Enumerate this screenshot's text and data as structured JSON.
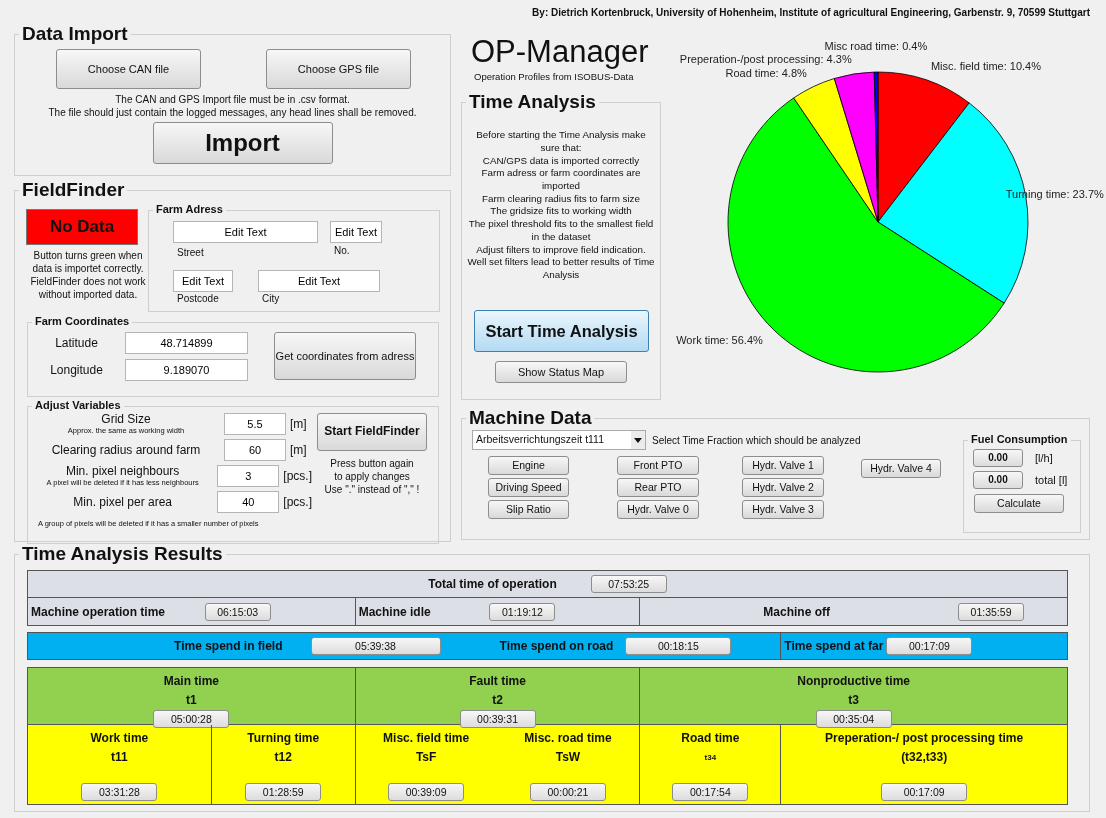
{
  "credit": "By: Dietrich Kortenbruck, University of Hohenheim, Institute of agricultural Engineering, Garbenstr. 9, 70599 Stuttgart",
  "data_import": {
    "title": "Data Import",
    "buttons": [
      "Choose CAN file",
      "Choose GPS file"
    ],
    "notes": [
      "The CAN and GPS Import file must be in .csv format.",
      "The file should just contain the logged messages, any head lines shall be removed."
    ],
    "import_button": "Import"
  },
  "field_finder": {
    "title": "FieldFinder",
    "status": {
      "label": "No Data",
      "has_data": false
    },
    "status_note": "Button turns green when data is importet correctly. FieldFinder does not work without imported data.",
    "farm_address": {
      "title": "Farm Adress",
      "inputs": [
        "Edit Text",
        "Edit Text",
        "Edit Text",
        "Edit Text"
      ],
      "captions": [
        "Street",
        "No.",
        "Postcode",
        "City"
      ]
    },
    "farm_coordinates": {
      "title": "Farm Coordinates",
      "fields": [
        {
          "label": "Latitude",
          "value": "48.714899"
        },
        {
          "label": "Longitude",
          "value": "9.189070"
        }
      ],
      "button": "Get coordinates from adress"
    },
    "adjust_variables": {
      "title": "Adjust Variables",
      "rows": [
        {
          "label": "Grid Size",
          "hint": "Approx. the same as working width",
          "value": "5.5",
          "unit": "[m]"
        },
        {
          "label": "Clearing radius around farm",
          "value": "60",
          "unit": "[m]"
        },
        {
          "label": "Min. pixel neighbours",
          "hint": "A pixel will be deleted if it has less neighbours",
          "value": "3",
          "unit": "[pcs.]"
        },
        {
          "label": "Min. pixel per area",
          "value": "40",
          "unit": "[pcs.]"
        }
      ],
      "footnote": "A group of pixels will be deleted if it has a smaller number of pixels",
      "button": "Start FieldFinder",
      "button_note_lines": [
        "Press button again",
        "to apply changes",
        "Use \".\" instead of \",\" !"
      ]
    }
  },
  "app": {
    "title": "OP-Manager",
    "subtitle": "Operation Profiles from ISOBUS-Data"
  },
  "time_analysis": {
    "title": "Time Analysis",
    "instructions": [
      "Before starting the Time Analysis make sure that:",
      "CAN/GPS data is imported correctly",
      "Farm adress or farm coordinates are imported",
      "Farm clearing radius fits to farm size",
      "The gridsize fits to working width",
      "The pixel threshold fits to the smallest field in the dataset",
      "Adjust filters to improve field indication.",
      "Well set filters lead to better results of Time Analysis"
    ],
    "start_button": {
      "label": "Start Time Analysis",
      "focused": true
    },
    "map_button": "Show Status Map"
  },
  "pie": {
    "chart_data": {
      "type": "pie",
      "values": [
        10.4,
        23.7,
        56.4,
        4.8,
        4.3,
        0.4
      ],
      "colors": [
        "#ff0000",
        "#00ffff",
        "#00ff00",
        "#ffff00",
        "#ff00ff",
        "#0000ff"
      ],
      "value_labels": [
        "Misc. field time: 10.4%",
        "Turning time: 23.7%",
        "Work time: 56.4%",
        "Road time: 4.8%",
        "Preperation-/post processing: 4.3%",
        "Misc road time: 0.4%"
      ]
    }
  },
  "machine_data": {
    "title": "Machine Data",
    "fraction_select": {
      "value": "Arbeitsverrichtungszeit t111"
    },
    "select_hint": "Select Time Fraction which should be analyzed",
    "button_columns": [
      [
        "Engine",
        "Driving Speed",
        "Slip Ratio"
      ],
      [
        "Front PTO",
        "Rear PTO",
        "Hydr. Valve 0"
      ],
      [
        "Hydr. Valve 1",
        "Hydr. Valve 2",
        "Hydr. Valve 3"
      ],
      [
        "Hydr. Valve 4"
      ]
    ],
    "fuel": {
      "title": "Fuel Consumption",
      "readings": [
        {
          "value": "0.00",
          "unit": "[l/h]"
        },
        {
          "value": "0.00",
          "unit": "total [l]"
        }
      ],
      "button": "Calculate"
    }
  },
  "results": {
    "title": "Time Analysis Results",
    "bands": [
      {
        "kind": "inline",
        "color": "#dcdfe6",
        "entries": [
          {
            "label": "Total time of operation",
            "value": "07:53:25"
          }
        ]
      },
      {
        "kind": "inline",
        "color": "#dcdfe6",
        "entries": [
          {
            "label": "Machine operation time",
            "value": "06:15:03"
          },
          {
            "label": "Machine idle",
            "value": "01:19:12"
          },
          {
            "label": "Machine off",
            "value": "01:35:59"
          }
        ]
      },
      {
        "kind": "inline",
        "color": "#00b0f0",
        "entries": [
          {
            "label": "Time spend in field",
            "value": "05:39:38"
          },
          {
            "label": "Time spend on road",
            "value": "00:18:15"
          },
          {
            "label": "Time spend at far",
            "value": "00:17:09"
          }
        ]
      },
      {
        "kind": "stacked",
        "color": "#92d050",
        "entries": [
          {
            "label": "Main time",
            "code": "t1",
            "value": "05:00:28"
          },
          {
            "label": "Fault time",
            "code": "t2",
            "value": "00:39:31"
          },
          {
            "label": "Nonproductive time",
            "code": "t3",
            "value": "00:35:04"
          }
        ]
      },
      {
        "kind": "stacked",
        "color": "#ffff00",
        "entries": [
          {
            "label": "Work time",
            "code": "t11",
            "value": "03:31:28"
          },
          {
            "label": "Turning time",
            "code": "t12",
            "value": "01:28:59"
          },
          {
            "label": "Misc. field time",
            "code": "TsF",
            "value": "00:39:09"
          },
          {
            "label": "Misc. road time",
            "code": "TsW",
            "value": "00:00:21"
          },
          {
            "label": "Road time",
            "code": "t34",
            "value": "00:17:54"
          },
          {
            "label": "Preperation-/ post processing time",
            "code": "(t32,t33)",
            "value": "00:17:09"
          }
        ]
      }
    ]
  }
}
